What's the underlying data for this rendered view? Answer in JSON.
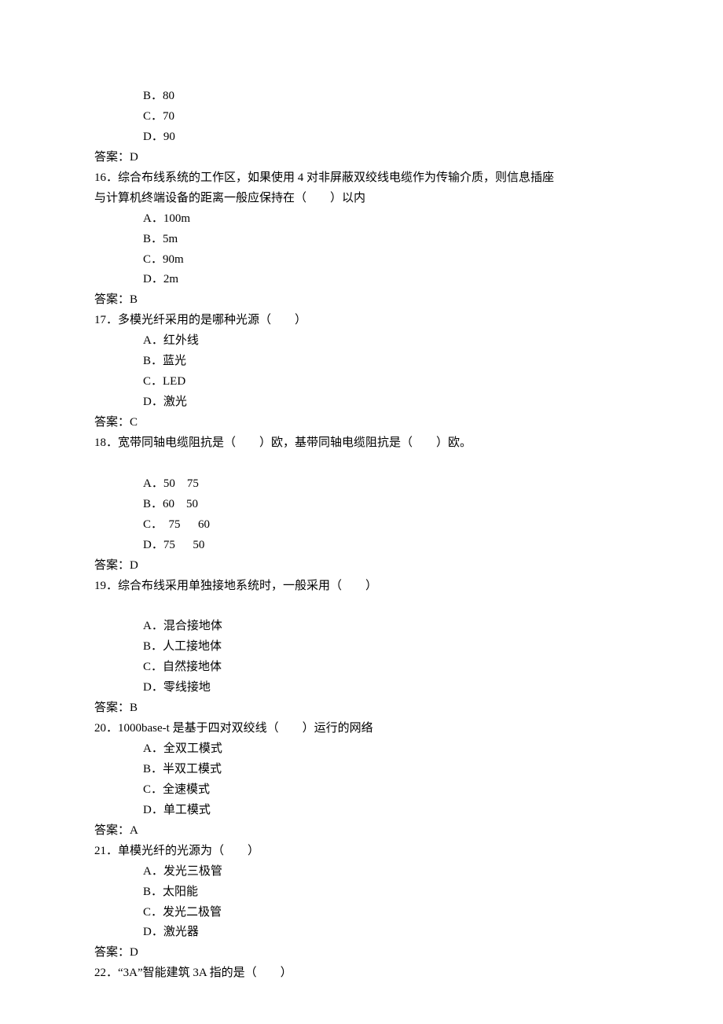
{
  "lines": [
    {
      "cls": "option",
      "text": "B．80"
    },
    {
      "cls": "option",
      "text": "C．70"
    },
    {
      "cls": "option",
      "text": "D．90"
    },
    {
      "cls": "answer",
      "text": "答案：D"
    },
    {
      "cls": "question",
      "text": "16．综合布线系统的工作区，如果使用 4 对非屏蔽双绞线电缆作为传输介质，则信息插座"
    },
    {
      "cls": "q-indent",
      "text": "与计算机终端设备的距离一般应保持在（　　）以内"
    },
    {
      "cls": "option",
      "text": "A．100m"
    },
    {
      "cls": "option",
      "text": "B．5m"
    },
    {
      "cls": "option",
      "text": "C．90m"
    },
    {
      "cls": "option",
      "text": "D．2m"
    },
    {
      "cls": "answer",
      "text": "答案：B"
    },
    {
      "cls": "question",
      "text": "17．多模光纤采用的是哪种光源（　　）"
    },
    {
      "cls": "option",
      "text": "A．红外线"
    },
    {
      "cls": "option",
      "text": "B．蓝光"
    },
    {
      "cls": "option",
      "text": "C．LED"
    },
    {
      "cls": "option",
      "text": "D．激光"
    },
    {
      "cls": "answer",
      "text": "答案：C"
    },
    {
      "cls": "question",
      "text": "18．宽带同轴电缆阻抗是（　　）欧，基带同轴电缆阻抗是（　　）欧。"
    },
    {
      "cls": "question",
      "text": " "
    },
    {
      "cls": "option",
      "text": "A．50　75"
    },
    {
      "cls": "option",
      "text": "B．60　50"
    },
    {
      "cls": "option",
      "text": "C． 75　 60"
    },
    {
      "cls": "option",
      "text": "D．75　 50"
    },
    {
      "cls": "answer",
      "text": "答案：D"
    },
    {
      "cls": "question",
      "text": "19．综合布线采用单独接地系统时，一般采用（　　）"
    },
    {
      "cls": "question",
      "text": " "
    },
    {
      "cls": "option",
      "text": "A．混合接地体"
    },
    {
      "cls": "option",
      "text": "B．人工接地体"
    },
    {
      "cls": "option",
      "text": "C．自然接地体"
    },
    {
      "cls": "option",
      "text": "D．零线接地"
    },
    {
      "cls": "answer",
      "text": "答案：B"
    },
    {
      "cls": "question",
      "text": "20．1000base-t 是基于四对双绞线（　　）运行的网络"
    },
    {
      "cls": "option",
      "text": "A．全双工模式"
    },
    {
      "cls": "option",
      "text": "B．半双工模式"
    },
    {
      "cls": "option",
      "text": "C．全速模式"
    },
    {
      "cls": "option",
      "text": "D．单工模式"
    },
    {
      "cls": "answer",
      "text": "答案：A"
    },
    {
      "cls": "question",
      "text": "21．单模光纤的光源为（　　）"
    },
    {
      "cls": "option",
      "text": "A．发光三极管"
    },
    {
      "cls": "option",
      "text": "B．太阳能"
    },
    {
      "cls": "option",
      "text": "C．发光二极管"
    },
    {
      "cls": "option",
      "text": "D．激光器"
    },
    {
      "cls": "answer",
      "text": "答案：D"
    },
    {
      "cls": "question",
      "text": "22．“3A”智能建筑 3A 指的是（　　）"
    }
  ]
}
